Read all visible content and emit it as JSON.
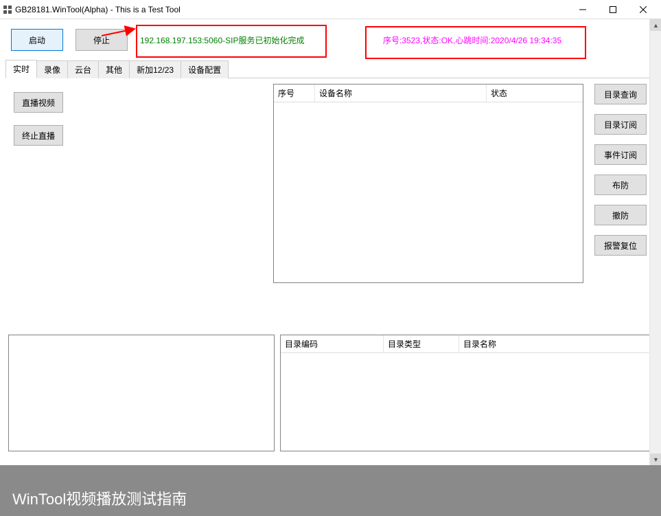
{
  "titlebar": {
    "title": "GB28181.WinTool(Alpha) - This is a Test Tool"
  },
  "toolbar": {
    "start_label": "启动",
    "stop_label": "停止"
  },
  "status": {
    "sip": "192.168.197.153:5060-SIP服务已初始化完成",
    "heartbeat": "序号:3523,状态:OK,心跳时间:2020/4/26 19:34:35"
  },
  "tabs": {
    "items": [
      {
        "label": "实时"
      },
      {
        "label": "录像"
      },
      {
        "label": "云台"
      },
      {
        "label": "其他"
      },
      {
        "label": "新加12/23"
      },
      {
        "label": "设备配置"
      }
    ],
    "active_index": 0
  },
  "left_actions": {
    "live_label": "直播视频",
    "stop_live_label": "终止直播"
  },
  "device_table": {
    "headers": {
      "seq": "序号",
      "name": "设备名称",
      "status": "状态"
    }
  },
  "side_buttons": {
    "catalog_query": "目录查询",
    "catalog_subscribe": "目录订阅",
    "event_subscribe": "事件订阅",
    "arm": "布防",
    "disarm": "撤防",
    "alarm_reset": "报警复位"
  },
  "catalog_table": {
    "headers": {
      "code": "目录编码",
      "type": "目录类型",
      "name": "目录名称"
    }
  },
  "footer": {
    "banner": "WinTool视频播放测试指南"
  },
  "colors": {
    "sip_text": "#008000",
    "heartbeat_text": "#ff00ff",
    "annotation": "#ff0000",
    "accent": "#0078d7"
  }
}
